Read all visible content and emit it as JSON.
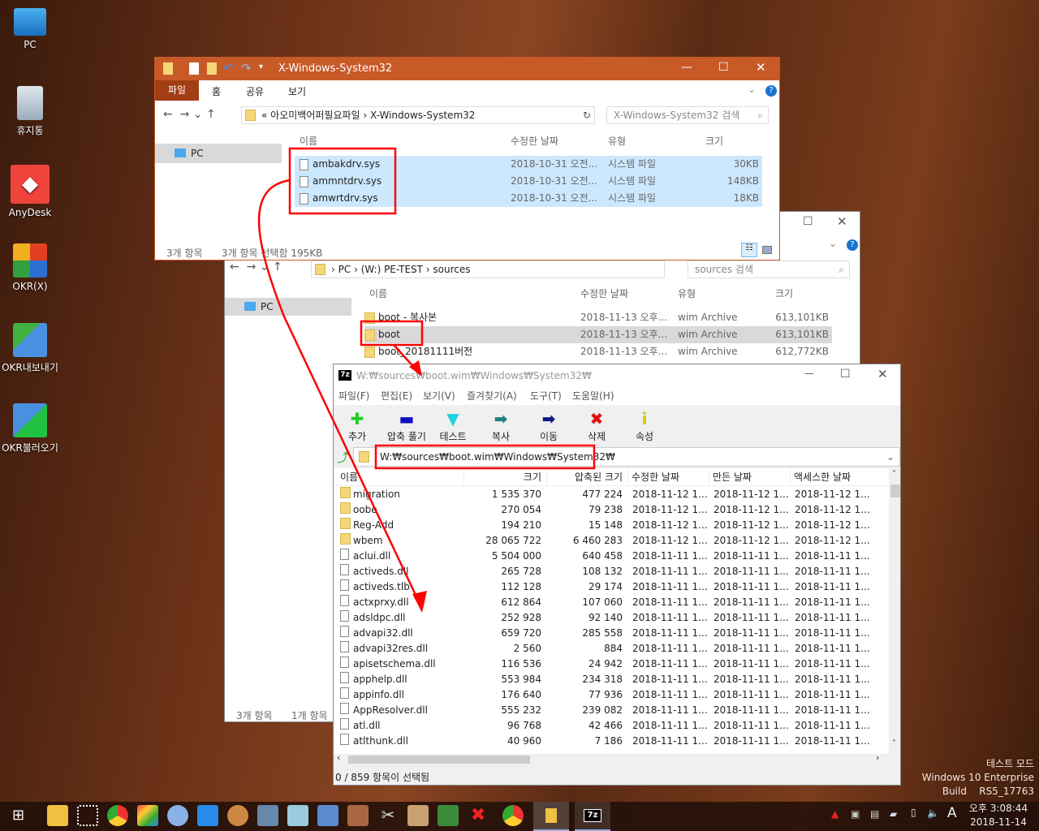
{
  "desktop": {
    "icons": [
      {
        "label": "PC",
        "icon": "computer-icon"
      },
      {
        "label": "휴지통",
        "icon": "recycle-bin-icon"
      },
      {
        "label": "AnyDesk",
        "icon": "anydesk-icon"
      },
      {
        "label": "OKR(X)",
        "icon": "office-icon"
      },
      {
        "label": "OKR내보내기",
        "icon": "export-icon"
      },
      {
        "label": "OKR불러오기",
        "icon": "import-icon"
      }
    ]
  },
  "front_explorer": {
    "title": "X-Windows-System32",
    "ribbon_tabs": [
      "파일",
      "홈",
      "공유",
      "보기"
    ],
    "breadcrumb": [
      "«",
      "아오미백어퍼필요파일",
      "X-Windows-System32"
    ],
    "search_placeholder": "X-Windows-System32 검색",
    "nav_pc": "PC",
    "columns": [
      "이름",
      "수정한 날짜",
      "유형",
      "크기"
    ],
    "files": [
      {
        "name": "ambakdrv.sys",
        "date": "2018-10-31 오전...",
        "type": "시스템 파일",
        "size": "30KB"
      },
      {
        "name": "ammntdrv.sys",
        "date": "2018-10-31 오전...",
        "type": "시스템 파일",
        "size": "148KB"
      },
      {
        "name": "amwrtdrv.sys",
        "date": "2018-10-31 오전...",
        "type": "시스템 파일",
        "size": "18KB"
      }
    ],
    "status_count": "3개 항목",
    "status_selected": "3개 항목 선택함 195KB"
  },
  "back_explorer": {
    "breadcrumb": [
      "PC",
      "(W:) PE-TEST",
      "sources"
    ],
    "search_placeholder": "sources 검색",
    "nav_pc": "PC",
    "columns": [
      "이름",
      "수정한 날짜",
      "유형",
      "크기"
    ],
    "files": [
      {
        "name": "boot - 복사본",
        "date": "2018-11-13 오후...",
        "type": "wim Archive",
        "size": "613,101KB"
      },
      {
        "name": "boot",
        "date": "2018-11-13 오후...",
        "type": "wim Archive",
        "size": "613,101KB"
      },
      {
        "name": "boot_20181111버전",
        "date": "2018-11-13 오후...",
        "type": "wim Archive",
        "size": "612,772KB"
      }
    ],
    "status_count": "3개 항목",
    "status_selected": "1개 항목"
  },
  "sevenzip": {
    "title": "W:₩sources₩boot.wim₩Windows₩System32₩",
    "menu": [
      "파일(F)",
      "편집(E)",
      "보기(V)",
      "즐겨찾기(A)",
      "도구(T)",
      "도움말(H)"
    ],
    "toolbar": [
      {
        "label": "추가",
        "icon": "plus-icon",
        "color": "#22cc22"
      },
      {
        "label": "압축 풀기",
        "icon": "minus-icon",
        "color": "#1010c0"
      },
      {
        "label": "테스트",
        "icon": "check-chevron-icon",
        "color": "#20d0e0"
      },
      {
        "label": "복사",
        "icon": "copy-arrow-icon",
        "color": "#208080"
      },
      {
        "label": "이동",
        "icon": "move-arrow-icon",
        "color": "#101880"
      },
      {
        "label": "삭제",
        "icon": "delete-x-icon",
        "color": "#e01010"
      },
      {
        "label": "속성",
        "icon": "info-icon",
        "color": "#e0d000"
      }
    ],
    "path": "W:₩sources₩boot.wim₩Windows₩System32₩",
    "columns": [
      "이름",
      "크기",
      "압축된 크기",
      "수정한 날짜",
      "만든 날짜",
      "액세스한 날짜"
    ],
    "rows": [
      [
        "migration",
        "1 535 370",
        "477 224",
        "2018-11-12 1...",
        "2018-11-12 1...",
        "2018-11-12 1...",
        "folder"
      ],
      [
        "oobe",
        "270 054",
        "79 238",
        "2018-11-12 1...",
        "2018-11-12 1...",
        "2018-11-12 1...",
        "folder"
      ],
      [
        "Reg-Add",
        "194 210",
        "15 148",
        "2018-11-12 1...",
        "2018-11-12 1...",
        "2018-11-12 1...",
        "folder"
      ],
      [
        "wbem",
        "28 065 722",
        "6 460 283",
        "2018-11-12 1...",
        "2018-11-12 1...",
        "2018-11-12 1...",
        "folder"
      ],
      [
        "aclui.dll",
        "5 504 000",
        "640 458",
        "2018-11-11 1...",
        "2018-11-11 1...",
        "2018-11-11 1...",
        "file"
      ],
      [
        "activeds.dll",
        "265 728",
        "108 132",
        "2018-11-11 1...",
        "2018-11-11 1...",
        "2018-11-11 1...",
        "file"
      ],
      [
        "activeds.tlb",
        "112 128",
        "29 174",
        "2018-11-11 1...",
        "2018-11-11 1...",
        "2018-11-11 1...",
        "file"
      ],
      [
        "actxprxy.dll",
        "612 864",
        "107 060",
        "2018-11-11 1...",
        "2018-11-11 1...",
        "2018-11-11 1...",
        "file"
      ],
      [
        "adsldpc.dll",
        "252 928",
        "92 140",
        "2018-11-11 1...",
        "2018-11-11 1...",
        "2018-11-11 1...",
        "file"
      ],
      [
        "advapi32.dll",
        "659 720",
        "285 558",
        "2018-11-11 1...",
        "2018-11-11 1...",
        "2018-11-11 1...",
        "file"
      ],
      [
        "advapi32res.dll",
        "2 560",
        "884",
        "2018-11-11 1...",
        "2018-11-11 1...",
        "2018-11-11 1...",
        "file"
      ],
      [
        "apisetschema.dll",
        "116 536",
        "24 942",
        "2018-11-11 1...",
        "2018-11-11 1...",
        "2018-11-11 1...",
        "file"
      ],
      [
        "apphelp.dll",
        "553 984",
        "234 318",
        "2018-11-11 1...",
        "2018-11-11 1...",
        "2018-11-11 1...",
        "file"
      ],
      [
        "appinfo.dll",
        "176 640",
        "77 936",
        "2018-11-11 1...",
        "2018-11-11 1...",
        "2018-11-11 1...",
        "file"
      ],
      [
        "AppResolver.dll",
        "555 232",
        "239 082",
        "2018-11-11 1...",
        "2018-11-11 1...",
        "2018-11-11 1...",
        "file"
      ],
      [
        "atl.dll",
        "96 768",
        "42 466",
        "2018-11-11 1...",
        "2018-11-11 1...",
        "2018-11-11 1...",
        "file"
      ],
      [
        "atlthunk.dll",
        "40 960",
        "7 186",
        "2018-11-11 1...",
        "2018-11-11 1...",
        "2018-11-11 1...",
        "file"
      ]
    ],
    "status": "0 / 859 항목이 선택됨"
  },
  "watermark": {
    "line1": "테스트 모드",
    "line2": "Windows 10 Enterprise",
    "line3": "Build    RS5_17763"
  },
  "clock": {
    "time": "오후 3:08:44",
    "date": "2018-11-14",
    "ime": "A"
  },
  "colors": {
    "explorer_title": "#c85a28",
    "ribbon_file_tab": "#a23d14",
    "selection": "#cce8ff",
    "annotation": "#ff0000"
  }
}
